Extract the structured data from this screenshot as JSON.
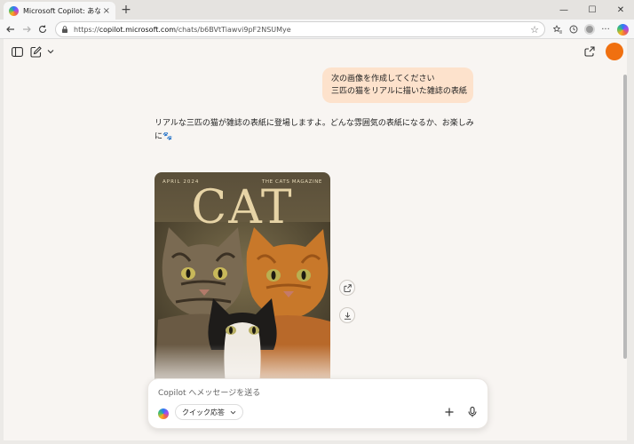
{
  "browser": {
    "tab_title": "Microsoft Copilot: あなたの AI アシ",
    "tab_close": "×",
    "new_tab": "+",
    "url_prefix": "https://",
    "url_host": "copilot.microsoft.com",
    "url_path": "/chats/b6BVtTiawvi9pF2NSUMye",
    "controls": {
      "minimize": "—",
      "maximize": "☐",
      "close": "✕"
    },
    "more": "···"
  },
  "chat": {
    "user_message": [
      "次の画像を作成してください",
      "三匹の猫をリアルに描いた雑誌の表紙"
    ],
    "reply": "リアルな三匹の猫が雑誌の表紙に登場しますよ。どんな雰囲気の表紙になるか、お楽しみに🐾"
  },
  "magazine": {
    "date": "APRIL 2024",
    "name": "THE CATS MAGAZINE",
    "title": "CAT"
  },
  "composer": {
    "placeholder": "Copilot へメッセージを送る",
    "mode": "クイック応答"
  },
  "colors": {
    "avatar": "#f07010",
    "user_bubble": "#fde2cc"
  },
  "icons": [
    "sidebar-icon",
    "new-chat-icon",
    "share-icon",
    "download-icon",
    "plus-icon",
    "microphone-icon"
  ]
}
